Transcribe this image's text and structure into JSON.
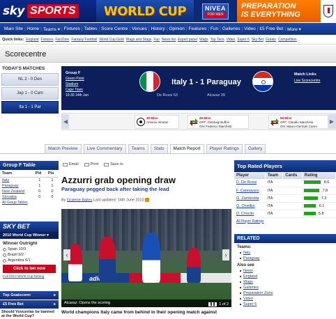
{
  "banner": {
    "sky_logo": "sky",
    "sports": "SPORTS",
    "world_cup": "WORLD CUP",
    "nivea_brand": "NIVEA",
    "nivea_sub": "FOR MEN",
    "prep_line1": "PREPARATION",
    "prep_line2": "IS EVERYTHING"
  },
  "main_nav": [
    "Main Site",
    "Home",
    "Teams ▾",
    "Fixtures",
    "Tables",
    "Score Centre",
    "Venues",
    "History",
    "Opinion",
    "Features",
    "Fun",
    "Galleries",
    "Video",
    "£5 Free Bet",
    "More ▾"
  ],
  "quick_links": {
    "label": "Quick links:",
    "items": [
      "England",
      "Fixtures",
      "FanZone",
      "Fantasy Football",
      "World Cup Gold",
      "Wags and Stags",
      "Fun",
      "News list",
      "Expert panel",
      "Wags",
      "Top Tens",
      "Video",
      "Super 6",
      "Sky Bet",
      "Greats",
      "Competition"
    ]
  },
  "scorecentre": {
    "title": "Scorecentre",
    "todays_matches_label": "TODAY'S MATCHES",
    "todays_matches": [
      "NL 2 - 0 Den",
      "Jap 1 - 0 Cam",
      "Ita 1 - 1 Par"
    ]
  },
  "match": {
    "group": "Group F",
    "venue_links": [
      "Green Point",
      "Stadium",
      "Cape Town"
    ],
    "kickoff": "19:30 14th Jun",
    "home": "Italy",
    "away": "Paraguay",
    "score": "1 - 1",
    "home_scorer": "De Rossi 63",
    "away_scorer": "Alcaraz 39",
    "links_label": "Match Links",
    "links": [
      "Live Scorecentre"
    ],
    "colors": {
      "italy": [
        "#009246",
        "#ffffff",
        "#ce2b37"
      ],
      "paraguay": [
        "#d52b1e",
        "#ffffff",
        "#0038a8"
      ]
    }
  },
  "events": [
    {
      "minute": "39 Mins",
      "text": "Antonio Alcaraz",
      "icon": "ball-icon"
    },
    {
      "minute": "46 Mins",
      "text": "OFF: Gianluigi Buffon",
      "text2": "ON: Federico Marchetti",
      "icon": "substitution-icon"
    },
    {
      "minute": "59 Mins",
      "text": "OFF: Claudio Marchisio",
      "text2": "ON: Mauro German Camo",
      "icon": "substitution-icon"
    }
  ],
  "tabs": [
    "Match Preview",
    "Live Commentary",
    "Teams",
    "Stats",
    "Match Report",
    "Player Ratings",
    "Gallery"
  ],
  "active_tab": "Match Report",
  "group_table": {
    "title": "Group F Table",
    "headers": [
      "Team",
      "Pld",
      "Pts"
    ],
    "rows": [
      [
        "Italy",
        "1",
        "1"
      ],
      [
        "Paraguay",
        "1",
        "1"
      ],
      [
        "New Zealand",
        "0",
        "0"
      ],
      [
        "Slovakia",
        "0",
        "0"
      ]
    ],
    "all_tables": "All Group Tables"
  },
  "skybet": {
    "logo": "SKY BET",
    "sub": "2010 World Cup Winner ▾",
    "winner_label": "Winner Outright",
    "options": [
      "Spain 10/3",
      "Brazil 9/2",
      "Argentina 6/1"
    ],
    "cta": "Click to bet now",
    "footer": "Full 2010 World Cup betting",
    "top_goalscorer": "Top Goalscorer",
    "free_bet": "£5 Free Bet",
    "poll": "Should Vuvuzelas be banned at the World Cup?"
  },
  "article": {
    "tools": [
      "Email",
      "Print",
      "Save to"
    ],
    "headline": "Azzurri grab opening draw",
    "subhead": "Paraguay pegged back after taking the lead",
    "byline_prefix": "By",
    "author": "Graeme Bailey",
    "updated": "Last updated: 14th June 2010",
    "photo_caption": "Alcaraz: Opens the scoring",
    "photo_pager": "1 of 2",
    "photo_board_text": "adidas",
    "lead": "World champions Italy came from behind in their opening match against"
  },
  "ratings": {
    "title": "Top Rated Players",
    "headers": [
      "Player",
      "Team",
      "Cards",
      "Rating"
    ],
    "rows": [
      {
        "player": "D. De Rossi",
        "team": "ITA",
        "rating": 8.6
      },
      {
        "player": "F. Cannavaro",
        "team": "ITA",
        "rating": 7.8
      },
      {
        "player": "G. Zambrotta",
        "team": "ITA",
        "rating": 7.2
      },
      {
        "player": "G. Chiellini",
        "team": "ITA",
        "rating": 6.1
      },
      {
        "player": "D. Criscito",
        "team": "ITA",
        "rating": 5.8
      }
    ],
    "all_ratings": "All Player Ratings",
    "bar_color": "#22a31b"
  },
  "related": {
    "title": "RELATED",
    "teams_label": "Teams:",
    "teams": [
      "Italy",
      "Paraguay"
    ],
    "also_label": "Also see",
    "also": [
      "News",
      "England",
      "Wags",
      "Galleries",
      "Preparation Zone",
      "Video",
      "Super 6"
    ]
  }
}
